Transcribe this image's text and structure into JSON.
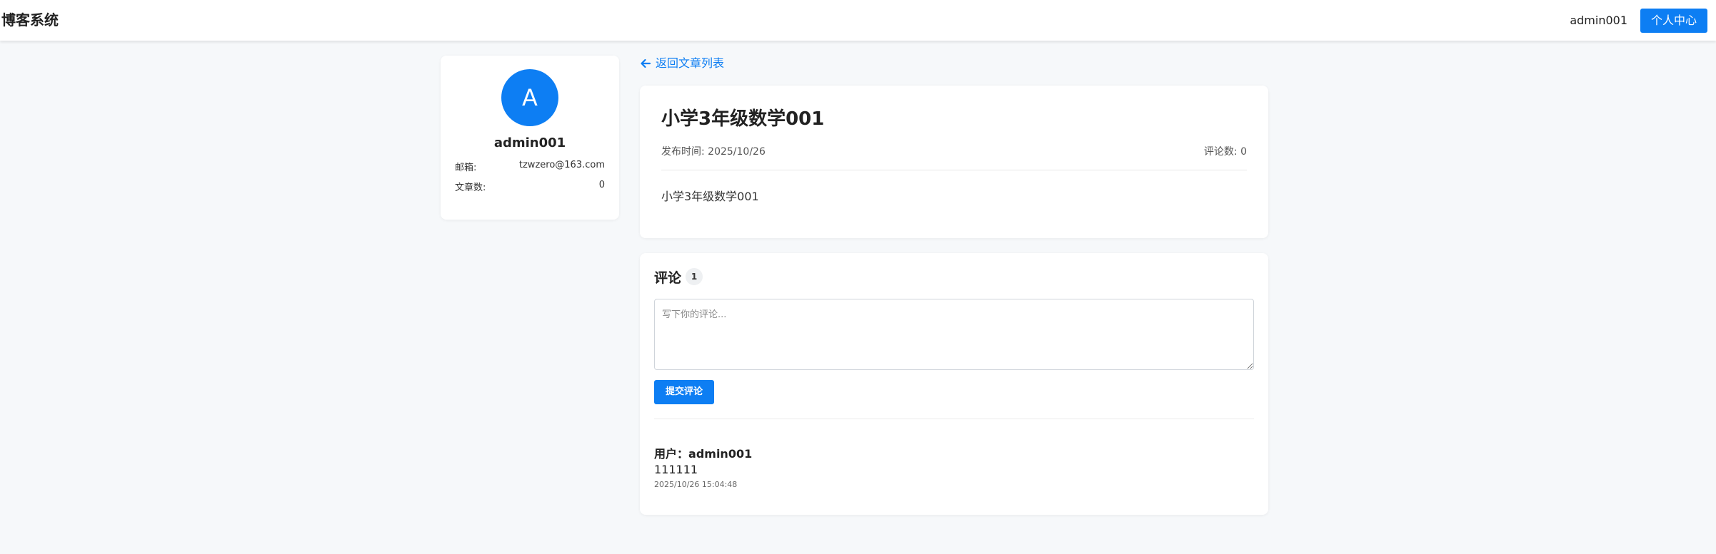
{
  "header": {
    "brand": "博客系统",
    "username": "admin001",
    "profile_button": "个人中心"
  },
  "profile": {
    "avatar_letter": "A",
    "name": "admin001",
    "email_label": "邮箱:",
    "email_value": "tzwzero@163.com",
    "posts_label": "文章数:",
    "posts_value": "0"
  },
  "nav": {
    "back_label": "返回文章列表"
  },
  "article": {
    "title": "小学3年级数学001",
    "published": "发布时间: 2025/10/26",
    "comment_count": "评论数: 0",
    "body": "小学3年级数学001"
  },
  "comments": {
    "heading": "评论",
    "count": "1",
    "placeholder": "写下你的评论...",
    "submit_label": "提交评论",
    "items": [
      {
        "user_label": "用户：",
        "user": "admin001",
        "text": "111111",
        "time": "2025/10/26 15:04:48"
      }
    ]
  },
  "colors": {
    "accent": "#0d7ef3",
    "background": "#f6f8fa",
    "card": "#ffffff"
  }
}
